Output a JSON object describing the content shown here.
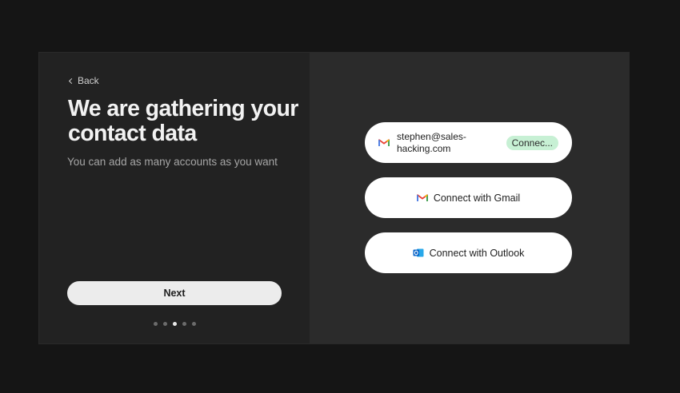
{
  "left": {
    "back_label": "Back",
    "title": "We are gathering your contact data",
    "subtitle": "You can add as many accounts as you want",
    "next_label": "Next",
    "steps": {
      "total": 5,
      "current": 3
    }
  },
  "right": {
    "connected_account": {
      "email": "stephen@sales-hacking.com",
      "status": "Connec...",
      "icon": "gmail-icon"
    },
    "gmail_button": {
      "label": "Connect with Gmail",
      "icon": "gmail-icon"
    },
    "outlook_button": {
      "label": "Connect with Outlook",
      "icon": "outlook-icon"
    }
  },
  "colors": {
    "background": "#151515",
    "left_panel": "#222222",
    "right_panel": "#2b2b2b",
    "status_badge": "#c7f0d4",
    "outlook_blue": "#0a64c8"
  }
}
